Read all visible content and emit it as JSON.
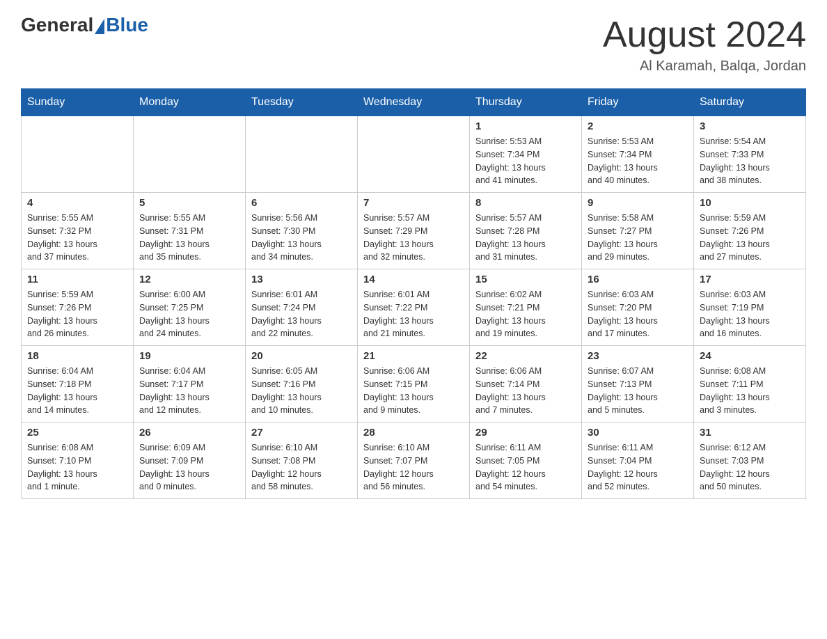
{
  "header": {
    "logo_general": "General",
    "logo_blue": "Blue",
    "month_title": "August 2024",
    "location": "Al Karamah, Balqa, Jordan"
  },
  "weekdays": [
    "Sunday",
    "Monday",
    "Tuesday",
    "Wednesday",
    "Thursday",
    "Friday",
    "Saturday"
  ],
  "weeks": [
    [
      {
        "day": "",
        "info": ""
      },
      {
        "day": "",
        "info": ""
      },
      {
        "day": "",
        "info": ""
      },
      {
        "day": "",
        "info": ""
      },
      {
        "day": "1",
        "info": "Sunrise: 5:53 AM\nSunset: 7:34 PM\nDaylight: 13 hours\nand 41 minutes."
      },
      {
        "day": "2",
        "info": "Sunrise: 5:53 AM\nSunset: 7:34 PM\nDaylight: 13 hours\nand 40 minutes."
      },
      {
        "day": "3",
        "info": "Sunrise: 5:54 AM\nSunset: 7:33 PM\nDaylight: 13 hours\nand 38 minutes."
      }
    ],
    [
      {
        "day": "4",
        "info": "Sunrise: 5:55 AM\nSunset: 7:32 PM\nDaylight: 13 hours\nand 37 minutes."
      },
      {
        "day": "5",
        "info": "Sunrise: 5:55 AM\nSunset: 7:31 PM\nDaylight: 13 hours\nand 35 minutes."
      },
      {
        "day": "6",
        "info": "Sunrise: 5:56 AM\nSunset: 7:30 PM\nDaylight: 13 hours\nand 34 minutes."
      },
      {
        "day": "7",
        "info": "Sunrise: 5:57 AM\nSunset: 7:29 PM\nDaylight: 13 hours\nand 32 minutes."
      },
      {
        "day": "8",
        "info": "Sunrise: 5:57 AM\nSunset: 7:28 PM\nDaylight: 13 hours\nand 31 minutes."
      },
      {
        "day": "9",
        "info": "Sunrise: 5:58 AM\nSunset: 7:27 PM\nDaylight: 13 hours\nand 29 minutes."
      },
      {
        "day": "10",
        "info": "Sunrise: 5:59 AM\nSunset: 7:26 PM\nDaylight: 13 hours\nand 27 minutes."
      }
    ],
    [
      {
        "day": "11",
        "info": "Sunrise: 5:59 AM\nSunset: 7:26 PM\nDaylight: 13 hours\nand 26 minutes."
      },
      {
        "day": "12",
        "info": "Sunrise: 6:00 AM\nSunset: 7:25 PM\nDaylight: 13 hours\nand 24 minutes."
      },
      {
        "day": "13",
        "info": "Sunrise: 6:01 AM\nSunset: 7:24 PM\nDaylight: 13 hours\nand 22 minutes."
      },
      {
        "day": "14",
        "info": "Sunrise: 6:01 AM\nSunset: 7:22 PM\nDaylight: 13 hours\nand 21 minutes."
      },
      {
        "day": "15",
        "info": "Sunrise: 6:02 AM\nSunset: 7:21 PM\nDaylight: 13 hours\nand 19 minutes."
      },
      {
        "day": "16",
        "info": "Sunrise: 6:03 AM\nSunset: 7:20 PM\nDaylight: 13 hours\nand 17 minutes."
      },
      {
        "day": "17",
        "info": "Sunrise: 6:03 AM\nSunset: 7:19 PM\nDaylight: 13 hours\nand 16 minutes."
      }
    ],
    [
      {
        "day": "18",
        "info": "Sunrise: 6:04 AM\nSunset: 7:18 PM\nDaylight: 13 hours\nand 14 minutes."
      },
      {
        "day": "19",
        "info": "Sunrise: 6:04 AM\nSunset: 7:17 PM\nDaylight: 13 hours\nand 12 minutes."
      },
      {
        "day": "20",
        "info": "Sunrise: 6:05 AM\nSunset: 7:16 PM\nDaylight: 13 hours\nand 10 minutes."
      },
      {
        "day": "21",
        "info": "Sunrise: 6:06 AM\nSunset: 7:15 PM\nDaylight: 13 hours\nand 9 minutes."
      },
      {
        "day": "22",
        "info": "Sunrise: 6:06 AM\nSunset: 7:14 PM\nDaylight: 13 hours\nand 7 minutes."
      },
      {
        "day": "23",
        "info": "Sunrise: 6:07 AM\nSunset: 7:13 PM\nDaylight: 13 hours\nand 5 minutes."
      },
      {
        "day": "24",
        "info": "Sunrise: 6:08 AM\nSunset: 7:11 PM\nDaylight: 13 hours\nand 3 minutes."
      }
    ],
    [
      {
        "day": "25",
        "info": "Sunrise: 6:08 AM\nSunset: 7:10 PM\nDaylight: 13 hours\nand 1 minute."
      },
      {
        "day": "26",
        "info": "Sunrise: 6:09 AM\nSunset: 7:09 PM\nDaylight: 13 hours\nand 0 minutes."
      },
      {
        "day": "27",
        "info": "Sunrise: 6:10 AM\nSunset: 7:08 PM\nDaylight: 12 hours\nand 58 minutes."
      },
      {
        "day": "28",
        "info": "Sunrise: 6:10 AM\nSunset: 7:07 PM\nDaylight: 12 hours\nand 56 minutes."
      },
      {
        "day": "29",
        "info": "Sunrise: 6:11 AM\nSunset: 7:05 PM\nDaylight: 12 hours\nand 54 minutes."
      },
      {
        "day": "30",
        "info": "Sunrise: 6:11 AM\nSunset: 7:04 PM\nDaylight: 12 hours\nand 52 minutes."
      },
      {
        "day": "31",
        "info": "Sunrise: 6:12 AM\nSunset: 7:03 PM\nDaylight: 12 hours\nand 50 minutes."
      }
    ]
  ]
}
